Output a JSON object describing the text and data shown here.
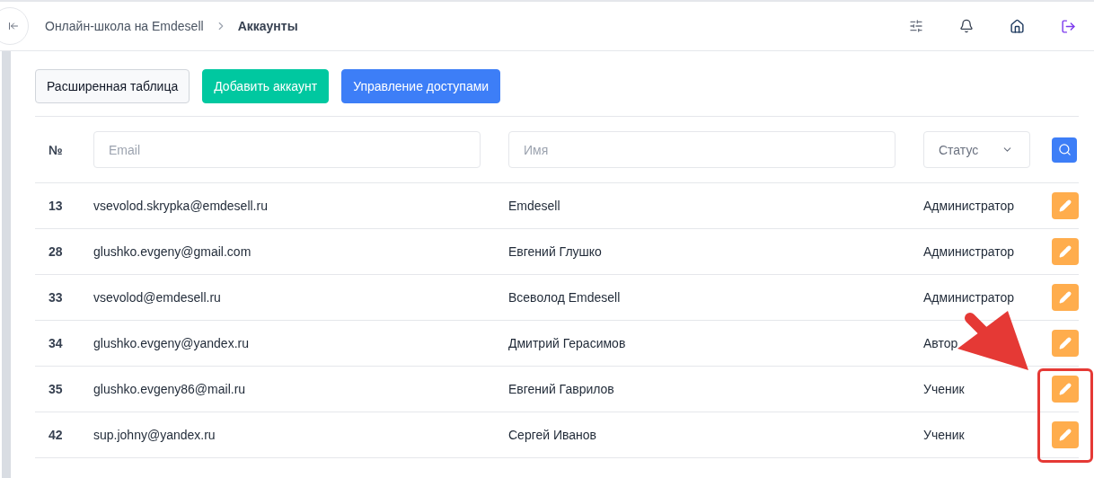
{
  "breadcrumbs": [
    {
      "label": "Онлайн-школа на Emdesell",
      "current": false
    },
    {
      "label": "Аккаунты",
      "current": true
    }
  ],
  "toolbar": [
    {
      "label": "Расширенная таблица",
      "kind": "outline"
    },
    {
      "label": "Добавить аккаунт",
      "kind": "success"
    },
    {
      "label": "Управление доступами",
      "kind": "primary"
    }
  ],
  "filters": {
    "number_label": "№",
    "email_placeholder": "Email",
    "name_placeholder": "Имя",
    "status_placeholder": "Статус"
  },
  "rows": [
    {
      "id": "13",
      "email": "vsevolod.skrypka@emdesell.ru",
      "name": "Emdesell",
      "status": "Администратор"
    },
    {
      "id": "28",
      "email": "glushko.evgeny@gmail.com",
      "name": "Евгений Глушко",
      "status": "Администратор"
    },
    {
      "id": "33",
      "email": "vsevolod@emdesell.ru",
      "name": "Всеволод Emdesell",
      "status": "Администратор"
    },
    {
      "id": "34",
      "email": "glushko.evgeny@yandex.ru",
      "name": "Дмитрий Герасимов",
      "status": "Автор"
    },
    {
      "id": "35",
      "email": "glushko.evgeny86@mail.ru",
      "name": "Евгений Гаврилов",
      "status": "Ученик"
    },
    {
      "id": "42",
      "email": "sup.johny@yandex.ru",
      "name": "Сергей Иванов",
      "status": "Ученик"
    }
  ],
  "annotation": {
    "arrow": true,
    "frame": true
  }
}
